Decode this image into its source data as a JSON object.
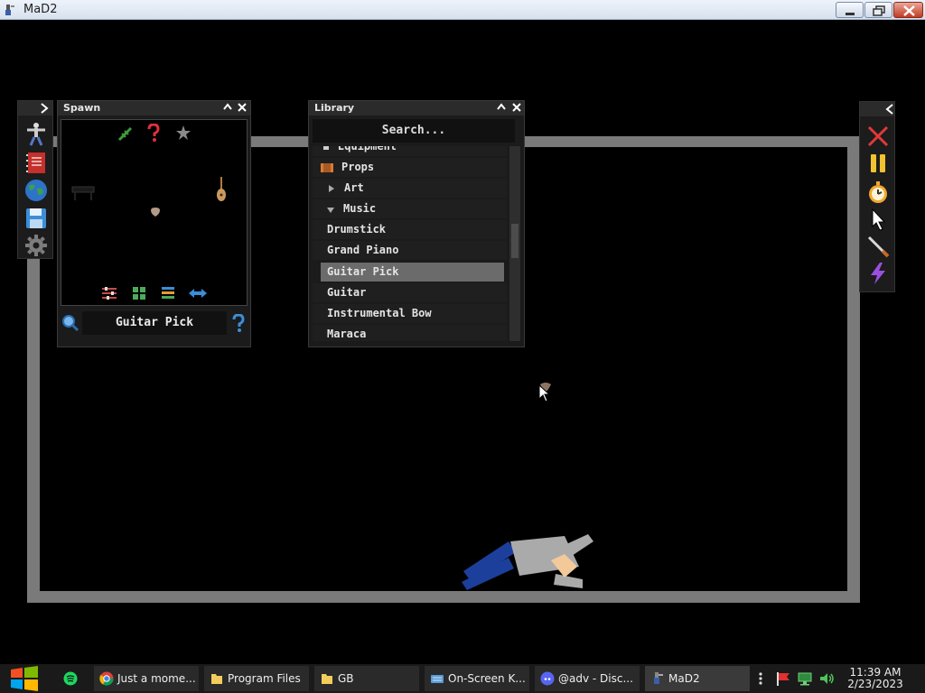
{
  "window": {
    "title": "MaD2"
  },
  "spawn": {
    "title": "Spawn",
    "selected_item": "Guitar Pick"
  },
  "library": {
    "title": "Library",
    "search_placeholder": "Search...",
    "items": [
      {
        "label": "Equipment",
        "type": "category"
      },
      {
        "label": "Props",
        "type": "category"
      },
      {
        "label": "Art",
        "type": "folder-collapsed"
      },
      {
        "label": "Music",
        "type": "folder-expanded"
      },
      {
        "label": "Drumstick",
        "type": "item"
      },
      {
        "label": "Grand Piano",
        "type": "item"
      },
      {
        "label": "Guitar Pick",
        "type": "item",
        "selected": true
      },
      {
        "label": "Guitar",
        "type": "item"
      },
      {
        "label": "Instrumental Bow",
        "type": "item"
      },
      {
        "label": "Maraca",
        "type": "item"
      }
    ]
  },
  "taskbar": {
    "tasks": [
      {
        "label": "Just a mome...",
        "icon": "chrome-icon"
      },
      {
        "label": "Program Files",
        "icon": "folder-icon"
      },
      {
        "label": "GB",
        "icon": "folder-icon"
      },
      {
        "label": "On-Screen K...",
        "icon": "keyboard-icon"
      },
      {
        "label": "@adv - Disc...",
        "icon": "discord-icon"
      },
      {
        "label": "MaD2",
        "icon": "mad2-icon"
      }
    ],
    "time": "11:39 AM",
    "date": "2/23/2023"
  },
  "colors": {
    "panel_bg": "#1b1b1b",
    "selected_row": "#6b6b6b",
    "wall": "#7a7a7a"
  }
}
